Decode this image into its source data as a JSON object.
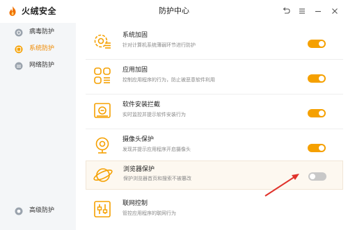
{
  "app": {
    "brand": "火绒安全",
    "title": "防护中心"
  },
  "window_controls": [
    {
      "icon": "back-icon"
    },
    {
      "icon": "menu-icon"
    },
    {
      "icon": "minimize-icon"
    },
    {
      "icon": "close-icon"
    }
  ],
  "sidebar": {
    "items": [
      {
        "label": "病毒防护",
        "icon": "virus-protection-icon",
        "active": false
      },
      {
        "label": "系统防护",
        "icon": "system-protection-icon",
        "active": true
      },
      {
        "label": "网络防护",
        "icon": "network-protection-icon",
        "active": false
      },
      {
        "label": "高级防护",
        "icon": "advanced-protection-icon",
        "active": false
      }
    ]
  },
  "rows": [
    {
      "title": "系统加固",
      "desc": "针对计算机系统薄弱环节进行防护",
      "icon": "gear-icon",
      "enabled": true
    },
    {
      "title": "应用加固",
      "desc": "控制应用程序的行为，防止被恶意软件利用",
      "icon": "apps-icon",
      "enabled": true
    },
    {
      "title": "软件安装拦截",
      "desc": "实时监控并提示软件安装行为",
      "icon": "install-block-icon",
      "enabled": true
    },
    {
      "title": "摄像头保护",
      "desc": "发现并提示应用程序开启摄像头",
      "icon": "camera-icon",
      "enabled": true
    },
    {
      "title": "浏览器保护",
      "desc": "保护浏览器首页和搜索不被篡改",
      "icon": "browser-icon",
      "enabled": false
    },
    {
      "title": "联网控制",
      "desc": "管控应用程序的联网行为",
      "icon": "network-control-icon",
      "enabled": null
    }
  ],
  "colors": {
    "accent": "#f5a000",
    "off": "#c8c8c8",
    "annotation": "#e0322b"
  }
}
